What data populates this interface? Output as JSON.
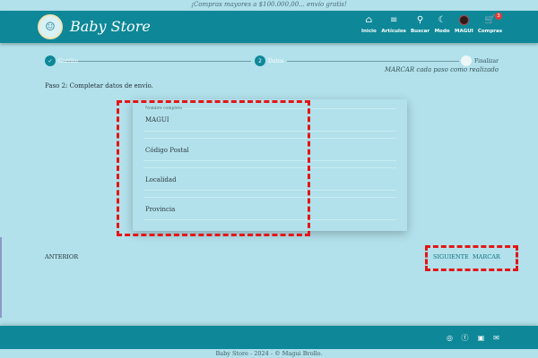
{
  "promo": {
    "text": "¡Compras mayores a $100.000,00... envío gratis!"
  },
  "header": {
    "brand": "Baby Store",
    "nav": [
      {
        "label": "Inicio",
        "icon": "home-icon",
        "glyph": "⌂"
      },
      {
        "label": "Artículos",
        "icon": "filter-icon",
        "glyph": "≡"
      },
      {
        "label": "Buscar",
        "icon": "search-icon",
        "glyph": "⚲"
      },
      {
        "label": "Modo",
        "icon": "moon-icon",
        "glyph": "☾"
      },
      {
        "label": "MAGUI",
        "icon": "avatar-icon",
        "glyph": ""
      },
      {
        "label": "Compras",
        "icon": "cart-icon",
        "glyph": "🛒",
        "badge": "3"
      }
    ]
  },
  "stepper": {
    "steps": [
      {
        "label": "Carrito",
        "marker": "✓",
        "state": "done"
      },
      {
        "label": "Datos",
        "marker": "2",
        "state": "active"
      },
      {
        "label": "Finalizar",
        "marker": "",
        "state": "todo"
      }
    ],
    "hint": "MARCAR cada paso como realizado"
  },
  "main": {
    "instruction": "Paso 2: Completar datos de envío.",
    "form": {
      "name_label": "Nombre completo",
      "name_value": "MAGUI",
      "postal_placeholder": "Código Postal",
      "city_placeholder": "Localidad",
      "province_placeholder": "Provincia"
    },
    "buttons": {
      "back": "ANTERIOR",
      "next": "SIGUIENTE",
      "mark": "MARCAR"
    }
  },
  "footer": {
    "social": [
      "instagram-icon",
      "facebook-icon",
      "linkedin-icon",
      "mail-icon"
    ],
    "copyright": "Baby Store - 2024 - © Magui Brollo."
  },
  "colors": {
    "primary": "#0e8898",
    "background": "#b2e1eb",
    "highlight": "#e41515"
  }
}
